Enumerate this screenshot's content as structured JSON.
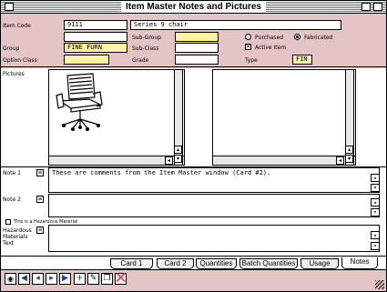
{
  "window": {
    "title": "Item Master Notes and Pictures"
  },
  "header": {
    "item_code_label": "Item Code",
    "item_code": "9111",
    "item_description": "Series 9 chair",
    "subgroup_label": "Sub-Group",
    "group_label": "Group",
    "group_value": "FINE FURN",
    "subclass_label": "Sub-Class",
    "option_class_label": "Option Class",
    "grade_label": "Grade",
    "purchased_label": "Purchased",
    "fabricated_label": "Fabricated",
    "fabricated_selected": true,
    "active_label": "Active Item",
    "active_checked": true,
    "type_label": "Type",
    "type_value": "FIN"
  },
  "pictures": {
    "label": "Pictures"
  },
  "notes": {
    "note1_label": "Note 1",
    "note1_text": "These are comments from the Item Master window (Card #2).",
    "note2_label": "Note 2",
    "note2_text": "",
    "hazard_checkbox_label": "This is a Hazardous Material",
    "hazard_text_label_1": "Hazardous",
    "hazard_text_label_2": "Materials",
    "hazard_text_label_3": "Text"
  },
  "tabs": [
    {
      "label": "Card 1"
    },
    {
      "label": "Card 2"
    },
    {
      "label": "Quantities"
    },
    {
      "label": "Batch Quantities"
    },
    {
      "label": "Usage"
    },
    {
      "label": "Notes"
    }
  ],
  "active_tab": "Notes",
  "toolbar_icons": [
    "binoculars-icon",
    "first-record-icon",
    "previous-record-icon",
    "next-record-icon",
    "last-record-icon",
    "add-record-icon",
    "edit-record-icon",
    "copy-record-icon",
    "delete-record-icon"
  ],
  "colors": {
    "header_bg": "#e4c4c4",
    "required_field": "#fdf3a0",
    "toolbar_icon": "#1a3aa5"
  }
}
